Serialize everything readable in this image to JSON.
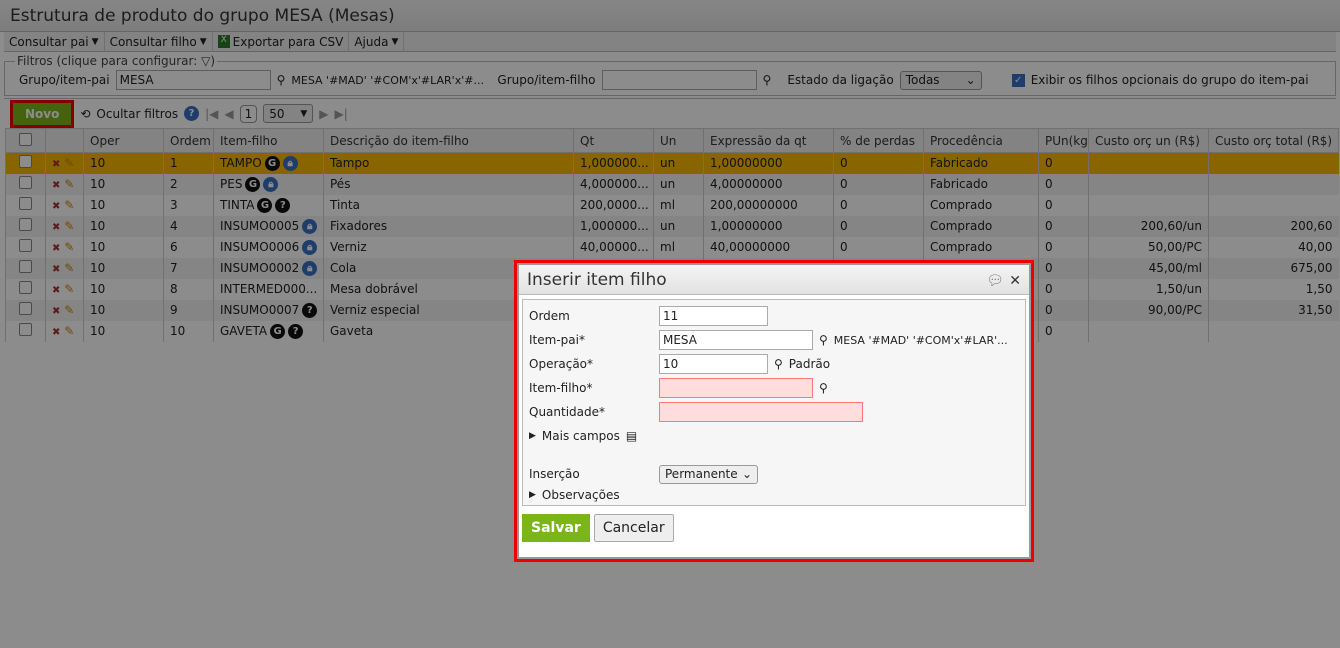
{
  "title": "Estrutura de produto do grupo MESA (Mesas)",
  "menu": {
    "consultar_pai": "Consultar pai",
    "consultar_filho": "Consultar filho",
    "exportar": "Exportar para CSV",
    "ajuda": "Ajuda"
  },
  "filters": {
    "legend": "Filtros (clique para configurar:",
    "legend_end": ")",
    "grupo_pai_label": "Grupo/item-pai",
    "grupo_pai_value": "MESA",
    "grupo_pai_desc": "MESA '#MAD' '#COM'x'#LAR'x'#...",
    "grupo_filho_label": "Grupo/item-filho",
    "grupo_filho_value": "",
    "estado_label": "Estado da ligação",
    "estado_value": "Todas",
    "exibir_label": "Exibir os filhos opcionais do grupo do item-pai"
  },
  "toolbar": {
    "novo": "Novo",
    "ocultar": "Ocultar filtros",
    "page": "1",
    "page_size": "50"
  },
  "columns": [
    "Oper",
    "Ordem",
    "Item-filho",
    "Descrição do item-filho",
    "Qt",
    "Un",
    "Expressão da qt",
    "% de perdas",
    "Procedência",
    "PUn(kg)",
    "Custo orç un (R$)",
    "Custo orç total (R$)"
  ],
  "rows": [
    {
      "oper": "10",
      "ordem": "1",
      "item": "TAMPO",
      "icons": [
        "g",
        "lock"
      ],
      "desc": "Tampo",
      "qt": "1,000000...",
      "un": "un",
      "expr": "1,00000000",
      "perdas": "0",
      "proc": "Fabricado",
      "pun": "0",
      "cun": "",
      "ctot": ""
    },
    {
      "oper": "10",
      "ordem": "2",
      "item": "PES",
      "icons": [
        "g",
        "lock"
      ],
      "desc": "Pés",
      "qt": "4,000000...",
      "un": "un",
      "expr": "4,00000000",
      "perdas": "0",
      "proc": "Fabricado",
      "pun": "0",
      "cun": "",
      "ctot": ""
    },
    {
      "oper": "10",
      "ordem": "3",
      "item": "TINTA",
      "icons": [
        "g",
        "q"
      ],
      "desc": "Tinta",
      "qt": "200,0000...",
      "un": "ml",
      "expr": "200,00000000",
      "perdas": "0",
      "proc": "Comprado",
      "pun": "0",
      "cun": "",
      "ctot": ""
    },
    {
      "oper": "10",
      "ordem": "4",
      "item": "INSUMO0005",
      "icons": [
        "lock"
      ],
      "desc": "Fixadores",
      "qt": "1,000000...",
      "un": "un",
      "expr": "1,00000000",
      "perdas": "0",
      "proc": "Comprado",
      "pun": "0",
      "cun": "200,60/un",
      "ctot": "200,60"
    },
    {
      "oper": "10",
      "ordem": "6",
      "item": "INSUMO0006",
      "icons": [
        "lock"
      ],
      "desc": "Verniz",
      "qt": "40,00000...",
      "un": "ml",
      "expr": "40,00000000",
      "perdas": "0",
      "proc": "Comprado",
      "pun": "0",
      "cun": "50,00/PC",
      "ctot": "40,00"
    },
    {
      "oper": "10",
      "ordem": "7",
      "item": "INSUMO0002",
      "icons": [
        "lock"
      ],
      "desc": "Cola",
      "qt": "",
      "un": "",
      "expr": "",
      "perdas": "",
      "proc": "",
      "pun": "0",
      "cun": "45,00/ml",
      "ctot": "675,00"
    },
    {
      "oper": "10",
      "ordem": "8",
      "item": "INTERMED000...",
      "icons": [],
      "desc": "Mesa dobrável",
      "qt": "",
      "un": "",
      "expr": "",
      "perdas": "",
      "proc": "",
      "pun": "0",
      "cun": "1,50/un",
      "ctot": "1,50"
    },
    {
      "oper": "10",
      "ordem": "9",
      "item": "INSUMO0007",
      "icons": [
        "q"
      ],
      "desc": "Verniz especial",
      "qt": "",
      "un": "",
      "expr": "",
      "perdas": "",
      "proc": "",
      "pun": "0",
      "cun": "90,00/PC",
      "ctot": "31,50"
    },
    {
      "oper": "10",
      "ordem": "10",
      "item": "GAVETA",
      "icons": [
        "g",
        "q"
      ],
      "desc": "Gaveta",
      "qt": "",
      "un": "",
      "expr": "",
      "perdas": "",
      "proc": "",
      "pun": "0",
      "cun": "",
      "ctot": ""
    }
  ],
  "modal": {
    "title": "Inserir item filho",
    "ordem_label": "Ordem",
    "ordem_value": "11",
    "pai_label": "Item-pai*",
    "pai_value": "MESA",
    "pai_desc": "MESA '#MAD' '#COM'x'#LAR'...",
    "op_label": "Operação*",
    "op_value": "10",
    "op_desc": "Padrão",
    "filho_label": "Item-filho*",
    "filho_value": "",
    "qtd_label": "Quantidade*",
    "qtd_value": "",
    "mais": "Mais campos",
    "insercao_label": "Inserção",
    "insercao_value": "Permanente",
    "obs": "Observações",
    "salvar": "Salvar",
    "cancelar": "Cancelar"
  }
}
